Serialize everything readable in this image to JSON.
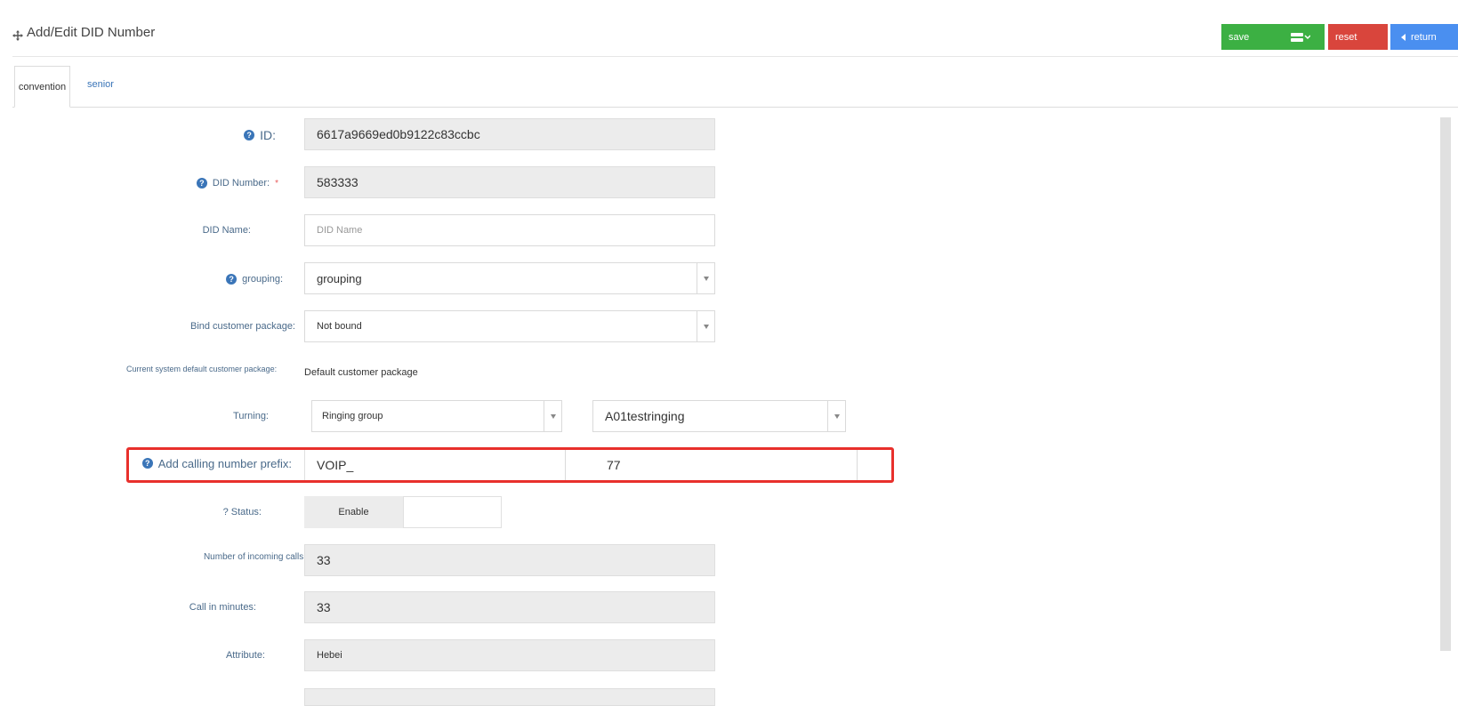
{
  "header": {
    "title": "Add/Edit DID Number",
    "title_icon": "move-icon",
    "buttons": {
      "save": "save",
      "reset": "reset",
      "return": "return"
    },
    "colors": {
      "save": "#3cb043",
      "reset": "#d9453c",
      "return": "#4a8ff0"
    }
  },
  "tabs": [
    {
      "label": "convention",
      "active": true
    },
    {
      "label": "senior",
      "active": false
    }
  ],
  "form": {
    "id": {
      "label": "ID:",
      "value": "6617a9669ed0b9122c83ccbc"
    },
    "did_number": {
      "label": "DID Number:",
      "required_mark": "*",
      "value": "583333"
    },
    "did_name": {
      "label": "DID Name:",
      "placeholder": "DID Name",
      "value": ""
    },
    "grouping": {
      "label": "grouping:",
      "value": "grouping"
    },
    "bind_package": {
      "label": "Bind customer package:",
      "value": "Not bound"
    },
    "default_package": {
      "label": "Current system default customer package:",
      "value": "Default customer package"
    },
    "turning": {
      "label": "Turning:",
      "type_value": "Ringing group",
      "target_value": "A01testringing"
    },
    "prefix": {
      "label": "Add calling number prefix:",
      "value1": "VOIP_",
      "value2": "77"
    },
    "status": {
      "label": "? Status:",
      "value": "Enable"
    },
    "incoming_calls": {
      "label": "Number of incoming calls:",
      "value": "33"
    },
    "call_minutes": {
      "label": "Call in minutes:",
      "value": "33"
    },
    "attribute": {
      "label": "Attribute:",
      "value": "Hebei"
    }
  }
}
